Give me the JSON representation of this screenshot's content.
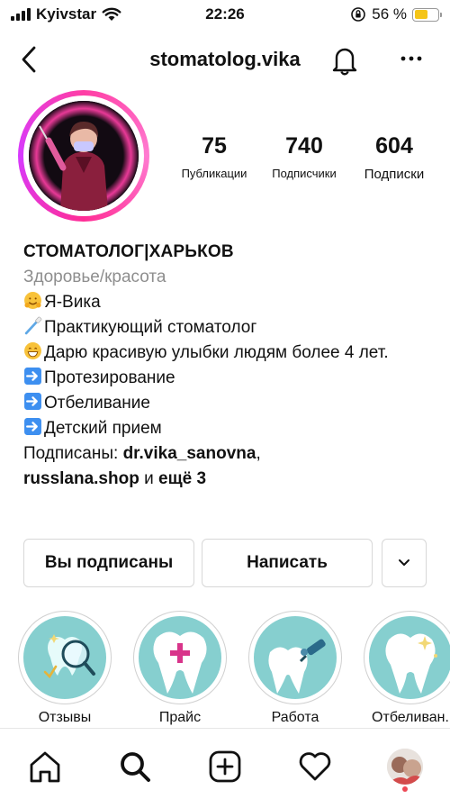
{
  "status_bar": {
    "carrier": "Kyivstar",
    "time": "22:26",
    "battery": "56 %",
    "battery_level": 0.56
  },
  "header": {
    "username": "stomatolog.vika"
  },
  "stats": [
    {
      "value": "75",
      "label": "Публикации"
    },
    {
      "value": "740",
      "label": "Подписчики"
    },
    {
      "value": "604",
      "label": "Подписки"
    }
  ],
  "bio": {
    "name": "СТОМАТОЛОГ|ХАРЬКОВ",
    "category": "Здоровье/красота",
    "lines": [
      "Я-Вика",
      "Практикующий стоматолог",
      "Дарю красивую улыбки людям более 4 лет.",
      "Протезирование",
      "Отбеливание",
      "Детский прием"
    ],
    "followed_by_prefix": "Подписаны: ",
    "followed_by_user1": "dr.vika_sanovna",
    "followed_by_sep": ",",
    "followed_by_user2": "russlana.shop",
    "followed_by_and": " и ",
    "followed_by_more": "ещё 3"
  },
  "buttons": {
    "following": "Вы подписаны",
    "message": "Написать"
  },
  "highlights": [
    {
      "label": "Отзывы",
      "icon": "magnifier-tooth-icon"
    },
    {
      "label": "Прайс",
      "icon": "tooth-plus-icon"
    },
    {
      "label": "Работа",
      "icon": "tooth-drill-icon"
    },
    {
      "label": "Отбеливан.",
      "icon": "tooth-sparkle-icon"
    }
  ],
  "tabbar": {
    "icons": [
      "home-icon",
      "search-icon",
      "add-post-icon",
      "heart-icon",
      "profile-avatar"
    ]
  },
  "colors": {
    "accent_ring": "#ff3ea5",
    "highlight_bg": "#86cfcf",
    "battery": "#f5c518",
    "notification_dot": "#ed4956"
  }
}
